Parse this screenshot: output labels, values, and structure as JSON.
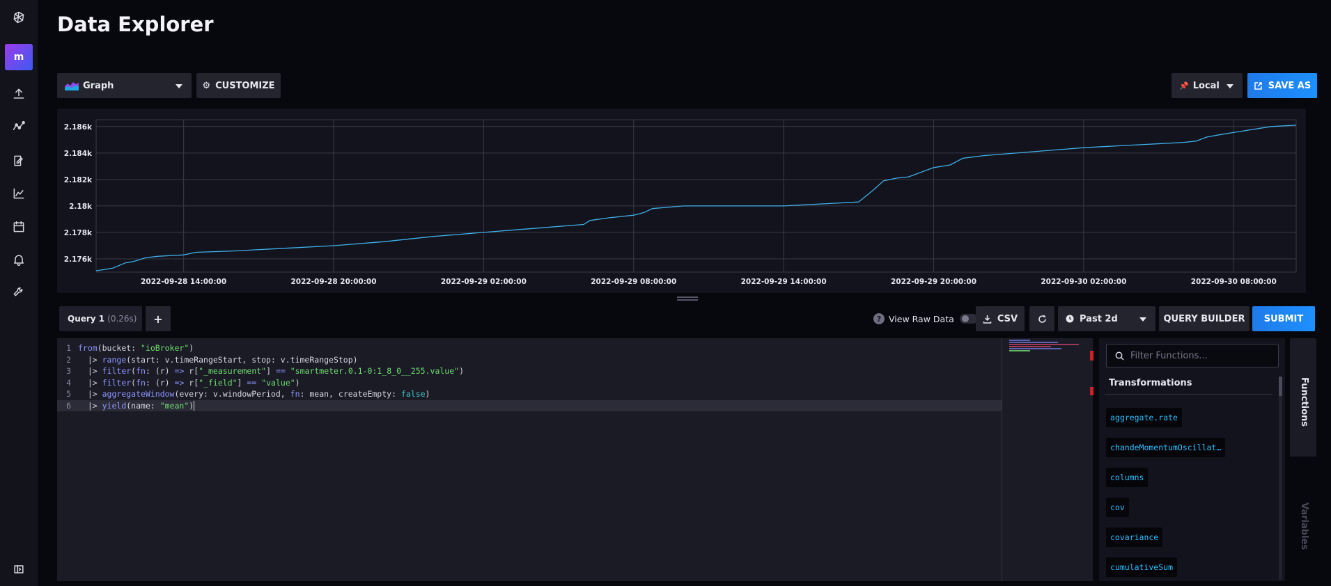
{
  "nav": {
    "icons": [
      "logo-icon",
      "upload-icon",
      "data-explorer-icon",
      "notebook-icon",
      "dashboard-icon",
      "tasks-icon",
      "alerts-icon",
      "settings-icon",
      "collapse-icon"
    ],
    "org_initial": "m"
  },
  "page": {
    "title": "Data Explorer"
  },
  "toolbar": {
    "vis_type": "Graph",
    "customize_label": "CUSTOMIZE",
    "timezone": "Local",
    "save_as_label": "SAVE AS"
  },
  "chart_data": {
    "type": "line",
    "title": "",
    "xlabel": "",
    "ylabel": "",
    "x_ticks": [
      "2022-09-28 14:00:00",
      "2022-09-28 20:00:00",
      "2022-09-29 02:00:00",
      "2022-09-29 08:00:00",
      "2022-09-29 14:00:00",
      "2022-09-29 20:00:00",
      "2022-09-30 02:00:00",
      "2022-09-30 08:00:00"
    ],
    "y_ticks": [
      "2.176k",
      "2.178k",
      "2.18k",
      "2.182k",
      "2.184k",
      "2.186k"
    ],
    "y_tick_values": [
      2176,
      2178,
      2180,
      2182,
      2184,
      2186
    ],
    "ylim": [
      2175.0,
      2186.2
    ],
    "xlim": [
      "2022-09-28 10:30:00",
      "2022-09-30 10:30:00"
    ],
    "grid": true,
    "series": [
      {
        "color": "#3fb0e8",
        "x": [
          "2022-09-28 10:30",
          "2022-09-28 11:10",
          "2022-09-28 11:40",
          "2022-09-28 12:00",
          "2022-09-28 12:30",
          "2022-09-28 13:00",
          "2022-09-28 14:00",
          "2022-09-28 14:30",
          "2022-09-28 16:00",
          "2022-09-28 18:00",
          "2022-09-28 20:00",
          "2022-09-28 22:00",
          "2022-09-29 00:00",
          "2022-09-29 02:00",
          "2022-09-29 04:00",
          "2022-09-29 06:00",
          "2022-09-29 06:15",
          "2022-09-29 07:00",
          "2022-09-29 08:00",
          "2022-09-29 08:25",
          "2022-09-29 08:45",
          "2022-09-29 10:00",
          "2022-09-29 12:00",
          "2022-09-29 14:00",
          "2022-09-29 16:00",
          "2022-09-29 17:00",
          "2022-09-29 17:35",
          "2022-09-29 18:00",
          "2022-09-29 18:30",
          "2022-09-29 19:00",
          "2022-09-29 20:00",
          "2022-09-29 20:40",
          "2022-09-29 21:10",
          "2022-09-29 22:00",
          "2022-09-30 00:00",
          "2022-09-30 02:00",
          "2022-09-30 04:00",
          "2022-09-30 06:00",
          "2022-09-30 06:30",
          "2022-09-30 06:55",
          "2022-09-30 07:30",
          "2022-09-30 08:30",
          "2022-09-30 09:30",
          "2022-09-30 10:30"
        ],
        "y": [
          2175.1,
          2175.3,
          2175.7,
          2175.8,
          2176.1,
          2176.2,
          2176.3,
          2176.5,
          2176.6,
          2176.8,
          2177.0,
          2177.3,
          2177.7,
          2178.0,
          2178.3,
          2178.6,
          2178.9,
          2179.1,
          2179.3,
          2179.5,
          2179.8,
          2180.0,
          2180.0,
          2180.0,
          2180.2,
          2180.3,
          2181.2,
          2181.9,
          2182.1,
          2182.2,
          2182.9,
          2183.1,
          2183.6,
          2183.8,
          2184.1,
          2184.4,
          2184.6,
          2184.8,
          2184.9,
          2185.2,
          2185.4,
          2185.7,
          2186.0,
          2186.1
        ]
      }
    ]
  },
  "query": {
    "tab_label": "Query 1",
    "tab_time": "(0.26s)",
    "add_label": "+",
    "view_raw_label": "View Raw Data",
    "csv_label": "CSV",
    "time_range": "Past 2d",
    "query_builder_label": "QUERY BUILDER",
    "submit_label": "SUBMIT"
  },
  "editor": {
    "lines": [
      {
        "n": "1",
        "parts": [
          [
            "kw",
            "from"
          ],
          [
            "plain",
            "(bucket: "
          ],
          [
            "str",
            "\"ioBroker\""
          ],
          [
            "plain",
            ")"
          ]
        ]
      },
      {
        "n": "2",
        "parts": [
          [
            "plain",
            "  |> "
          ],
          [
            "fn",
            "range"
          ],
          [
            "plain",
            "(start: v.timeRangeStart, stop: v.timeRangeStop)"
          ]
        ]
      },
      {
        "n": "3",
        "parts": [
          [
            "plain",
            "  |> "
          ],
          [
            "fn",
            "filter"
          ],
          [
            "plain",
            "("
          ],
          [
            "fn",
            "fn"
          ],
          [
            "plain",
            ": (r) "
          ],
          [
            "kw",
            "=>"
          ],
          [
            "plain",
            " r["
          ],
          [
            "str",
            "\"_measurement\""
          ],
          [
            "plain",
            "] "
          ],
          [
            "kw",
            "=="
          ],
          [
            "plain",
            " "
          ],
          [
            "str",
            "\"smartmeter.0.1-0:1_8_0__255.value\""
          ],
          [
            "plain",
            ")"
          ]
        ]
      },
      {
        "n": "4",
        "parts": [
          [
            "plain",
            "  |> "
          ],
          [
            "fn",
            "filter"
          ],
          [
            "plain",
            "("
          ],
          [
            "fn",
            "fn"
          ],
          [
            "plain",
            ": (r) "
          ],
          [
            "kw",
            "=>"
          ],
          [
            "plain",
            " r["
          ],
          [
            "str",
            "\"_field\""
          ],
          [
            "plain",
            "] "
          ],
          [
            "kw",
            "=="
          ],
          [
            "plain",
            " "
          ],
          [
            "str",
            "\"value\""
          ],
          [
            "plain",
            ")"
          ]
        ]
      },
      {
        "n": "5",
        "parts": [
          [
            "plain",
            "  |> "
          ],
          [
            "fn",
            "aggregateWindow"
          ],
          [
            "plain",
            "(every: v.windowPeriod, "
          ],
          [
            "fn",
            "fn"
          ],
          [
            "plain",
            ": mean, createEmpty: "
          ],
          [
            "bool",
            "false"
          ],
          [
            "plain",
            ")"
          ]
        ]
      },
      {
        "n": "6",
        "parts": [
          [
            "plain",
            "  |> "
          ],
          [
            "fn",
            "yield"
          ],
          [
            "plain",
            "(name: "
          ],
          [
            "str",
            "\"mean\""
          ],
          [
            "plain",
            ")"
          ]
        ]
      }
    ]
  },
  "functions": {
    "search_placeholder": "Filter Functions...",
    "section": "Transformations",
    "items": [
      "aggregate.rate",
      "chandeMomentumOscillat…",
      "columns",
      "cov",
      "covariance",
      "cumulativeSum"
    ],
    "tab_functions": "Functions",
    "tab_variables": "Variables"
  }
}
